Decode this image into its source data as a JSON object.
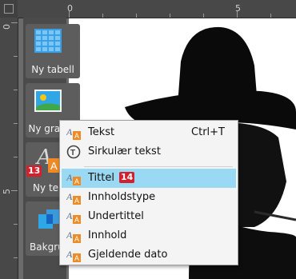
{
  "ruler": {
    "top_marks": [
      "0",
      "5"
    ],
    "left_marks": [
      "0",
      "5"
    ]
  },
  "tiles": [
    {
      "label": "Ny tabell"
    },
    {
      "label": "Ny grafikk"
    },
    {
      "label": "Ny tekst",
      "badge": "13"
    },
    {
      "label": "Bakgrunn"
    }
  ],
  "context_menu": {
    "items": [
      {
        "label": "Tekst",
        "shortcut": "Ctrl+T"
      },
      {
        "label": "Sirkulær tekst"
      },
      {
        "label": "Tittel",
        "badge": "14",
        "selected": true
      },
      {
        "label": "Innholdstype"
      },
      {
        "label": "Undertittel"
      },
      {
        "label": "Innhold"
      },
      {
        "label": "Gjeldende dato"
      }
    ]
  },
  "colors": {
    "accent_selected": "#99d9f3",
    "badge": "#d4202e",
    "panel": "#4b4b4b"
  }
}
